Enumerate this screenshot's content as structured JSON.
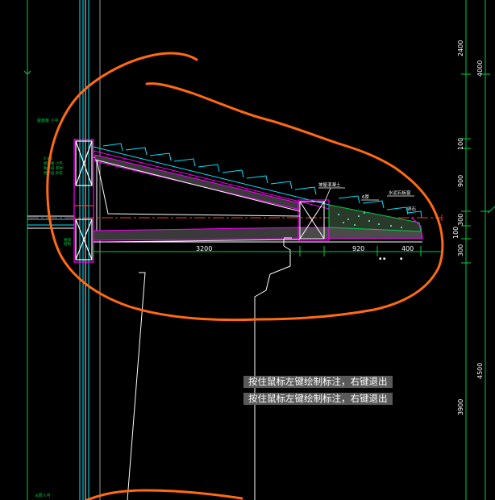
{
  "tooltips": [
    "按住鼠标左键绘制标注，右键退出",
    "按住鼠标左键绘制标注，右键退出"
  ],
  "dimensions": {
    "horizontal": [
      "3200",
      "920",
      "400"
    ],
    "vertical_right": [
      "2400",
      "4000",
      "100",
      "900",
      "300",
      "100",
      "300",
      "3900",
      "4500"
    ]
  },
  "labels": {
    "left_annotation_1": "Xb 1",
    "bottom_left": "ଖ层人可"
  },
  "colors": {
    "background": "#000000",
    "markup_stroke": "#ff6a13",
    "wall_cyan": "#00e5ff",
    "dim_green": "#00cc44",
    "magenta": "#ff00ff",
    "white": "#ffffff",
    "red": "#ff3030",
    "yellow": "#ffff00"
  }
}
